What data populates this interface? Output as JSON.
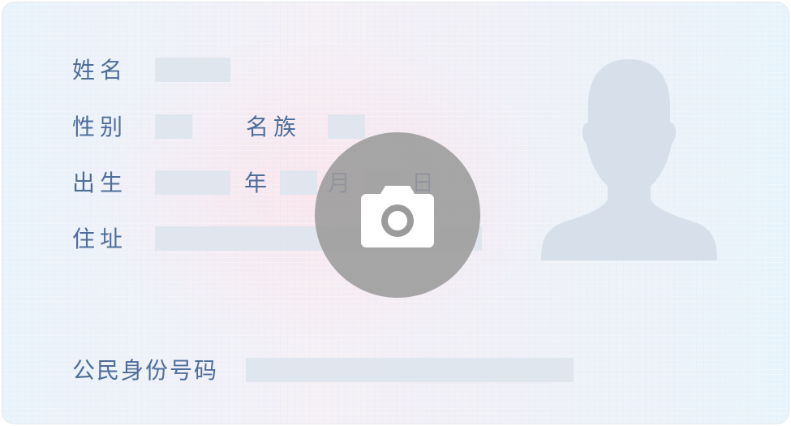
{
  "id_card": {
    "labels": {
      "name": "姓名",
      "gender": "性别",
      "ethnicity": "名族",
      "birth": "出生",
      "year": "年",
      "month": "月",
      "day": "日",
      "address": "住址",
      "id_number": "公民身份号码"
    }
  },
  "camera_button": {
    "icon": "camera-icon"
  },
  "portrait": {
    "icon": "person-silhouette-icon"
  },
  "colors": {
    "label_text": "#4f6d9a",
    "mask": "#dde4ec",
    "silhouette": "#d7dfea",
    "camera_overlay": "#9b9b9b"
  }
}
